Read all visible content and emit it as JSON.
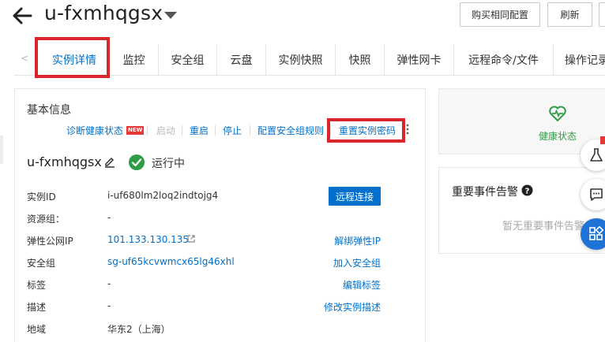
{
  "header": {
    "title": "u-fxmhqgsx",
    "buttons": [
      "购买相同配置",
      "刷新"
    ]
  },
  "tabs": [
    "实例详情",
    "监控",
    "安全组",
    "云盘",
    "实例快照",
    "快照",
    "弹性网卡",
    "远程命令/文件",
    "操作记录"
  ],
  "basic": {
    "title": "基本信息",
    "actions": {
      "diagnose": "诊断健康状态",
      "new_badge": "NEW",
      "start": "启动",
      "restart": "重启",
      "stop": "停止",
      "config_sg_rule": "配置安全组规则",
      "reset_password": "重置实例密码"
    },
    "instance_name": "u-fxmhqgsx",
    "status": "运行中",
    "rows": {
      "id_label": "实例ID",
      "id_value": "i-uf680lm2loq2indtojg4",
      "remote": "远程连接",
      "rg_label": "资源组：",
      "rg_value": "-",
      "eip_label": "弹性公网IP",
      "eip_value": "101.133.130.135",
      "eip_action": "解绑弹性IP",
      "sg_label": "安全组",
      "sg_value": "sg-uf65kcvwmcx65lg46xhl",
      "sg_action": "加入安全组",
      "tag_label": "标签",
      "tag_value": "-",
      "tag_action": "编辑标签",
      "desc_label": "描述",
      "desc_value": "-",
      "desc_action": "修改实例描述",
      "region_label": "地域",
      "region_value": "华东2（上海）"
    }
  },
  "health": {
    "label": "健康状态"
  },
  "events": {
    "title": "重要事件告警",
    "empty": "暂无重要事件告警"
  },
  "colors": {
    "accent": "#0070cc",
    "highlight": "#d9262c",
    "running": "#2e9d45"
  }
}
